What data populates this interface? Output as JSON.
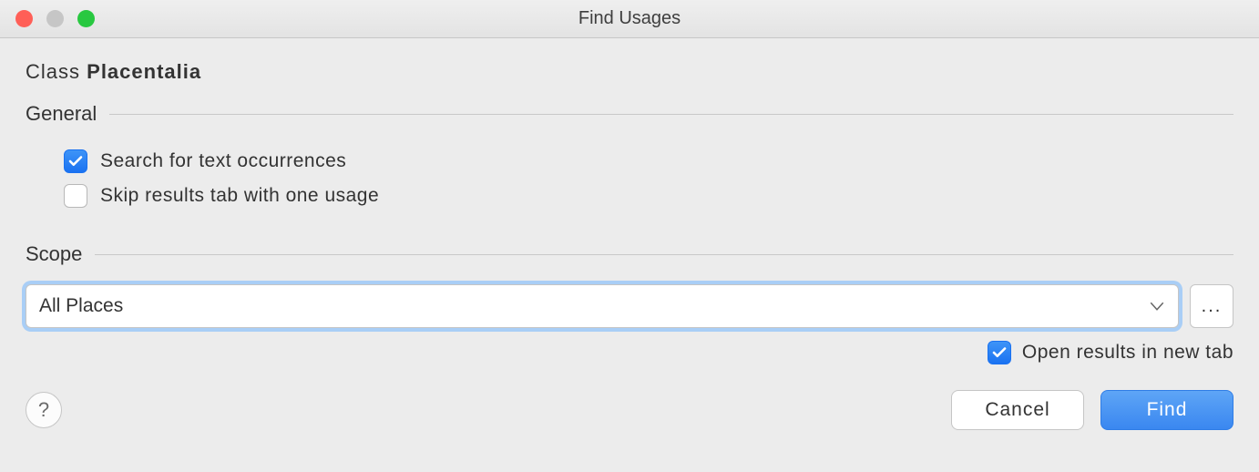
{
  "window": {
    "title": "Find Usages"
  },
  "subject": {
    "prefix": "Class",
    "name": "Placentalia"
  },
  "groups": {
    "general": {
      "label": "General",
      "options": {
        "search_text_occurrences": {
          "label": "Search for text occurrences",
          "checked": true
        },
        "skip_results_tab": {
          "label": "Skip results tab with one usage",
          "checked": false
        }
      }
    },
    "scope": {
      "label": "Scope",
      "selected": "All Places"
    }
  },
  "results": {
    "open_new_tab": {
      "label": "Open results in new tab",
      "checked": true
    }
  },
  "buttons": {
    "help": "?",
    "cancel": "Cancel",
    "find": "Find",
    "more": "..."
  }
}
